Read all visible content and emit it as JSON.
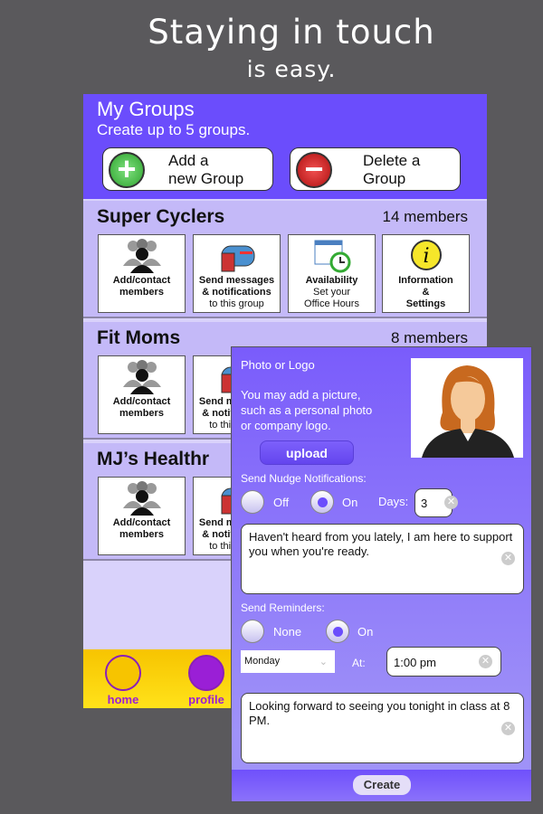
{
  "headline": {
    "line1": "Staying in touch",
    "line2": "is easy."
  },
  "header": {
    "title": "My Groups",
    "subtitle": "Create up to 5 groups.",
    "add_button": [
      "Add a",
      "new Group"
    ],
    "delete_button": [
      "Delete a",
      "Group"
    ]
  },
  "groups": [
    {
      "name": "Super Cyclers",
      "members": "14 members"
    },
    {
      "name": "Fit Moms",
      "members": "8 members"
    },
    {
      "name": "MJ’s Healthr",
      "members": ""
    }
  ],
  "tiles": {
    "contact": [
      "Add/contact",
      "members"
    ],
    "messages": [
      "Send messages",
      "& notifications",
      "to this group"
    ],
    "availability": [
      "Availability",
      "Set your",
      "Office Hours"
    ],
    "info": [
      "Information",
      "&",
      "Settings"
    ]
  },
  "nav": {
    "home": "home",
    "profile": "profile"
  },
  "panel": {
    "photo_label": "Photo or Logo",
    "photo_help": [
      "You may add a picture,",
      "such as a personal photo",
      "or company logo."
    ],
    "upload": "upload",
    "nudge_label": "Send Nudge Notifications:",
    "nudge_off": "Off",
    "nudge_on": "On",
    "nudge_selected": "On",
    "days_label": "Days:",
    "days_value": "3",
    "nudge_message": "Haven't heard from you lately, I am here to support you when you're ready.",
    "reminders_label": "Send Reminders:",
    "rem_none": "None",
    "rem_on": "On",
    "rem_selected": "On",
    "day_select": "Monday",
    "at_label": "At:",
    "time_value": "1:00 pm",
    "reminder_message": "Looking forward to seeing you tonight in class at 8 PM.",
    "create": "Create"
  },
  "colors": {
    "header": "#6b4dfc",
    "group_bg": "#c4b9f8",
    "nav": "#f7c400",
    "add": "#3cb83c",
    "delete": "#c81a1a"
  }
}
